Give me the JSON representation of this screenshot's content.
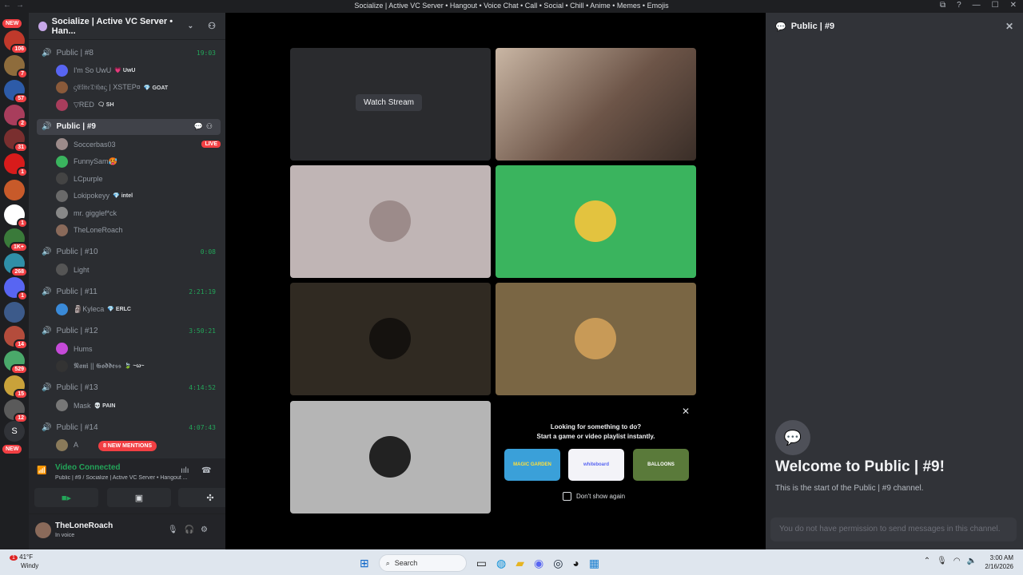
{
  "window": {
    "title": "Socialize | Active VC Server • Hangout • Voice Chat • Call • Social • Chill • Anime • Memes • Emojis",
    "min": "—",
    "max": "☐",
    "close": "✕"
  },
  "servers": {
    "new_top": "NEW",
    "new_bottom": "NEW",
    "badges": [
      "106",
      "7",
      "57",
      "2",
      "31",
      "1",
      "",
      "1",
      "1K+",
      "268",
      "1",
      "",
      "14",
      "529",
      "15",
      "12",
      ""
    ],
    "s_letter": "S"
  },
  "server": {
    "name": "Socialize | Active VC Server • Han..."
  },
  "channels": [
    {
      "name": "Public | #8",
      "time": "19:03",
      "users": [
        {
          "name": "I'm So UwU",
          "tag": "💗 UwU"
        },
        {
          "name": "ᦓ𝔈𝔩𝔦𝔱𝔢𝔇𝔦𝔥𝔞ᦓ | XSTEP¤",
          "tag": "💎 GOAT"
        },
        {
          "name": "▽RED",
          "tag": "🗨 SH"
        }
      ]
    },
    {
      "name": "Public | #9",
      "selected": true,
      "users": [
        {
          "name": "Soccerbas03",
          "live": "LIVE"
        },
        {
          "name": "FunnySam🥵"
        },
        {
          "name": "LCpurple"
        },
        {
          "name": "Lokipokeyy",
          "tag": "💎 intel"
        },
        {
          "name": "mr. gigglef*ck"
        },
        {
          "name": "TheLoneRoach"
        }
      ]
    },
    {
      "name": "Public | #10",
      "time": "0:08",
      "users": [
        {
          "name": "Light"
        }
      ]
    },
    {
      "name": "Public | #11",
      "time": "2:21:19",
      "users": [
        {
          "name": "🗿Kyleca",
          "tag": "💎 ERLC"
        }
      ]
    },
    {
      "name": "Public | #12",
      "time": "3:50:21",
      "users": [
        {
          "name": "Hums"
        },
        {
          "name": "𝕹𝖆𝖓𝖎 || 𝕲𝖔𝖉𝖉𝖊𝖘𝖘",
          "tag": "🍃 ~ω~"
        }
      ]
    },
    {
      "name": "Public | #13",
      "time": "4:14:52",
      "users": [
        {
          "name": "Mask",
          "tag": "💀 PAIN"
        }
      ]
    },
    {
      "name": "Public | #14",
      "time": "4:07:43",
      "users": [
        {
          "name": "A"
        }
      ]
    }
  ],
  "mentions": "8 NEW MENTIONS",
  "voice": {
    "status": "Video Connected",
    "sub": "Public | #9 / Socialize | Active VC Server • Hangout ..."
  },
  "user": {
    "name": "TheLoneRoach",
    "status": "In voice"
  },
  "stage": {
    "watch_stream": "Watch Stream",
    "promo_line1": "Looking for something to do?",
    "promo_line2": "Start a game or video playlist instantly.",
    "activities": [
      "MAGIC GARDEN",
      "whiteboard",
      "BALLOONS"
    ],
    "dont_show": "Don't show again"
  },
  "right": {
    "header": "Public | #9",
    "welcome": "Welcome to Public | #9!",
    "start": "This is the start of the Public | #9 channel.",
    "perm": "You do not have permission to send messages in this channel."
  },
  "taskbar": {
    "temp": "41°F",
    "weather": "Windy",
    "search": "Search",
    "time": "3:00 AM",
    "date": "2/16/2026",
    "weather_badge": "1"
  },
  "colors": {
    "accent": "#23a559",
    "danger": "#f23f43",
    "tile_green": "#3ab45e",
    "tile_pink": "#c0b5b5",
    "tile_brown": "#7a6644"
  }
}
